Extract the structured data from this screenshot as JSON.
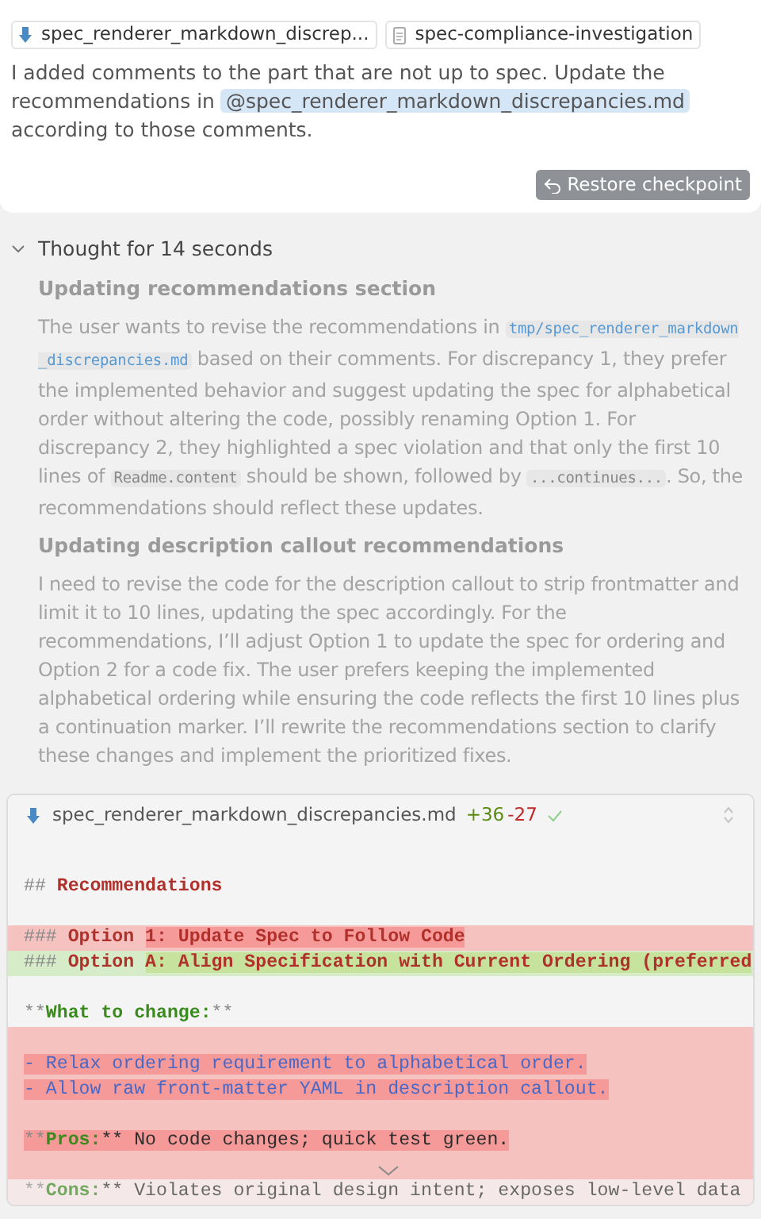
{
  "message": {
    "chips": [
      {
        "kind": "markdown",
        "label": "spec_renderer_markdown_discrep..."
      },
      {
        "kind": "document",
        "label": "spec-compliance-investigation"
      }
    ],
    "text_before": "I added comments to the part that are not up to spec. Update the recommendations in",
    "mention": "@spec_renderer_markdown_discrepancies.md",
    "text_after": "according to those comments.",
    "restore_button": "Restore checkpoint"
  },
  "thought": {
    "title": "Thought for 14 seconds",
    "expanded": true,
    "sections": [
      {
        "heading": "Updating recommendations section",
        "parts": [
          {
            "text": "The user wants to revise the recommendations in ",
            "kind": "text"
          },
          {
            "text": "tmp/spec_renderer_markdown_discrepancies.md",
            "kind": "path"
          },
          {
            "text": " based on their comments. For discrepancy 1, they prefer the implemented behavior and suggest updating the spec for alphabetical order without altering the code, possibly renaming Option 1. For discrepancy 2, they highlighted a spec violation and that only the first 10 lines of ",
            "kind": "text"
          },
          {
            "text": "Readme.content",
            "kind": "code"
          },
          {
            "text": " should be shown, followed by ",
            "kind": "text"
          },
          {
            "text": "...continues...",
            "kind": "code"
          },
          {
            "text": ". So, the recommendations should reflect these updates.",
            "kind": "text"
          }
        ]
      },
      {
        "heading": "Updating description callout recommendations",
        "parts": [
          {
            "text": "I need to revise the code for the description callout to strip frontmatter and limit it to 10 lines, updating the spec accordingly. For the recommendations, I’ll adjust Option 1 to update the spec for ordering and Option 2 for a code fix. The user prefers keeping the implemented alphabetical ordering while ensuring the code reflects the first 10 lines plus a continuation marker. I’ll rewrite the recommendations section to clarify these changes and implement the prioritized fixes.",
            "kind": "text"
          }
        ]
      }
    ]
  },
  "diff": {
    "file": "spec_renderer_markdown_discrepancies.md",
    "added": "+36",
    "removed": "-27",
    "applied": true,
    "lines": [
      {
        "kind": "blank"
      },
      {
        "kind": "context",
        "spans": [
          {
            "text": "## ",
            "kind": "marker"
          },
          {
            "text": "Recommendations",
            "kind": "heading"
          }
        ]
      },
      {
        "kind": "blank"
      },
      {
        "kind": "removed",
        "spans": [
          {
            "text": "### ",
            "kind": "marker",
            "changed": false
          },
          {
            "text": "Option ",
            "kind": "heading",
            "changed": false
          },
          {
            "text": "1: Update Spec to Follow Code",
            "kind": "heading",
            "changed": true
          }
        ]
      },
      {
        "kind": "added",
        "spans": [
          {
            "text": "### ",
            "kind": "marker",
            "changed": false
          },
          {
            "text": "Option ",
            "kind": "heading",
            "changed": false
          },
          {
            "text": "A: Align Specification with Current Ordering (preferred",
            "kind": "heading",
            "changed": true
          }
        ]
      },
      {
        "kind": "blank"
      },
      {
        "kind": "context",
        "spans": [
          {
            "text": "**",
            "kind": "marker"
          },
          {
            "text": "What to change:",
            "kind": "strong"
          },
          {
            "text": "**",
            "kind": "marker"
          }
        ]
      },
      {
        "kind": "removed"
      },
      {
        "kind": "removed",
        "spans": [
          {
            "text": "- Relax ordering requirement to alphabetical order.",
            "kind": "list",
            "changed": true
          }
        ]
      },
      {
        "kind": "removed",
        "spans": [
          {
            "text": "- Allow raw front-matter YAML in description callout.",
            "kind": "list",
            "changed": true
          }
        ]
      },
      {
        "kind": "removed"
      },
      {
        "kind": "removed",
        "spans": [
          {
            "text": "**",
            "kind": "marker",
            "changed": true
          },
          {
            "text": "Pros:",
            "kind": "strong",
            "changed": true
          },
          {
            "text": "** No code changes; quick test green.",
            "kind": "plain",
            "changed": true
          }
        ]
      },
      {
        "kind": "removed"
      },
      {
        "kind": "faded",
        "spans": [
          {
            "text": "**",
            "kind": "marker"
          },
          {
            "text": "Cons:",
            "kind": "strong"
          },
          {
            "text": "** Violates original design intent; exposes low-level data",
            "kind": "plain"
          }
        ]
      }
    ]
  }
}
